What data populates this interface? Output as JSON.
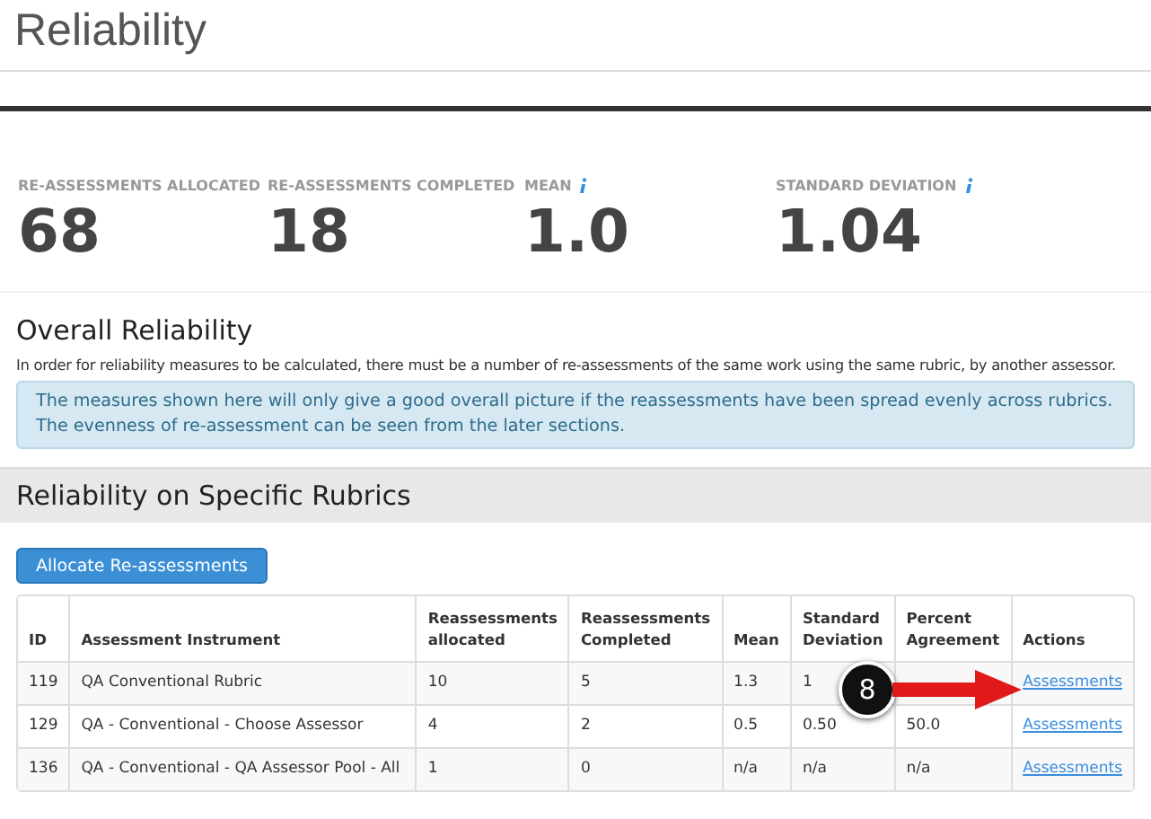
{
  "page": {
    "title": "Reliability"
  },
  "stats": [
    {
      "label": "RE-ASSESSMENTS ALLOCATED",
      "value": "68",
      "info": false
    },
    {
      "label": "RE-ASSESSMENTS COMPLETED",
      "value": "18",
      "info": false
    },
    {
      "label": "MEAN",
      "value": "1.0",
      "info": true
    },
    {
      "label": "STANDARD DEVIATION",
      "value": "1.04",
      "info": true
    }
  ],
  "overall": {
    "heading": "Overall Reliability",
    "text": "In order for reliability measures to be calculated, there must be a number of re-assessments of the same work using the same rubric, by another assessor.",
    "notice": "The measures shown here will only give a good overall picture if the reassessments have been spread evenly across rubrics. The evenness of re-assessment can be seen from the later sections."
  },
  "rubrics": {
    "heading": "Reliability on Specific Rubrics",
    "button": "Allocate Re-assessments",
    "columns": [
      "ID",
      "Assessment Instrument",
      "Reassessments allocated",
      "Reassessments Completed",
      "Mean",
      "Standard Deviation",
      "Percent Agreement",
      "Actions"
    ],
    "rows": [
      {
        "cells": [
          "119",
          "QA Conventional Rubric",
          "10",
          "5",
          "1.3",
          "1",
          ""
        ],
        "action": "Assessments"
      },
      {
        "cells": [
          "129",
          "QA - Conventional - Choose Assessor",
          "4",
          "2",
          "0.5",
          "0.50",
          "50.0"
        ],
        "action": "Assessments"
      },
      {
        "cells": [
          "136",
          "QA - Conventional - QA Assessor Pool - All",
          "1",
          "0",
          "n/a",
          "n/a",
          "n/a"
        ],
        "action": "Assessments"
      }
    ]
  },
  "callout": {
    "label": "8"
  }
}
